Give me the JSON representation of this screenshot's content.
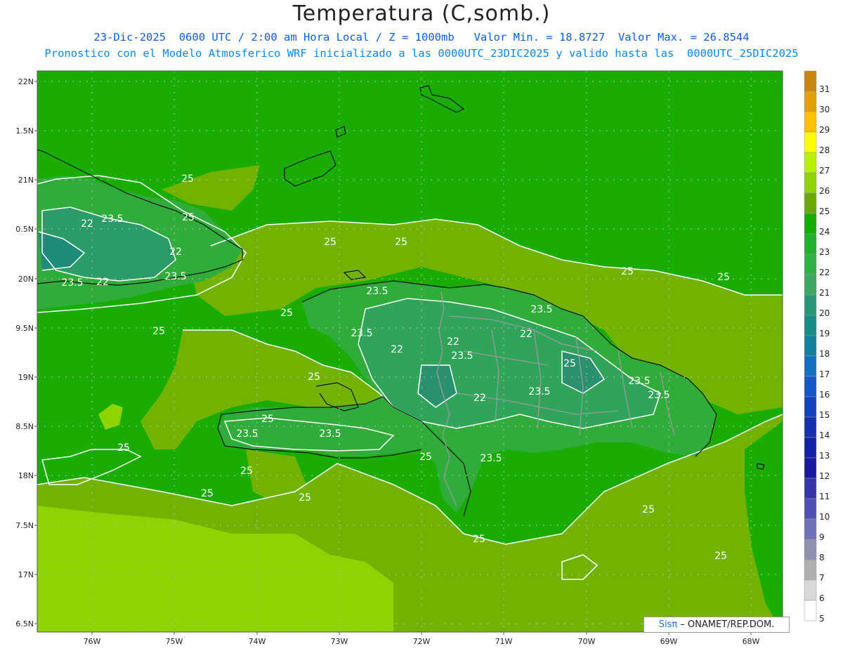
{
  "header": {
    "title": "Temperatura (C,somb.)",
    "line1": "23-Dic-2025  0600 UTC / 2:00 am Hora Local / Z = 1000mb   Valor Min. = 18.8727  Valor Max. = 26.8544",
    "line2": "Pronostico con el Modelo Atmosferico WRF inicializado a las 0000UTC_23DIC2025 y valido hasta las  0000UTC_25DIC2025"
  },
  "axes": {
    "lat_ticks": [
      "22N",
      "1.5N",
      "21N",
      "0.5N",
      "20N",
      "9.5N",
      "19N",
      "8.5N",
      "18N",
      "7.5N",
      "17N",
      "6.5N"
    ],
    "lon_ticks": [
      "76W",
      "75W",
      "74W",
      "73W",
      "72W",
      "71W",
      "70W",
      "69W",
      "68W"
    ]
  },
  "colorbar": {
    "labels": [
      "31",
      "30",
      "29",
      "28",
      "27",
      "26",
      "25",
      "24",
      "23",
      "22",
      "21",
      "20",
      "19",
      "18",
      "17",
      "16",
      "15",
      "14",
      "13",
      "12",
      "11",
      "10",
      "9",
      "8",
      "7",
      "6",
      "5"
    ],
    "colors": [
      "#c8860a",
      "#e0a000",
      "#ffc000",
      "#ffff00",
      "#b8f000",
      "#8ed400",
      "#6aaa00",
      "#15ad00",
      "#22b030",
      "#30b045",
      "#3ea860",
      "#2a9878",
      "#1a8c88",
      "#1480a0",
      "#1570c0",
      "#1556c8",
      "#1540c0",
      "#1530b0",
      "#1520a8",
      "#1a1aa0",
      "#3535a8",
      "#5050b0",
      "#7070b8",
      "#9090b0",
      "#b0b0b0",
      "#d8d8d8",
      "#ffffff"
    ]
  },
  "contour_labels": [
    "25",
    "25",
    "23.5",
    "22",
    "22",
    "23.5",
    "22",
    "23.5",
    "25",
    "25",
    "25",
    "25",
    "25",
    "25",
    "23.5",
    "23.5",
    "22",
    "23.5",
    "22",
    "23.5",
    "22",
    "25",
    "23.5",
    "22",
    "23.5",
    "23.5",
    "25",
    "25",
    "23.5",
    "23.5",
    "25",
    "25",
    "23.5",
    "25",
    "25",
    "25",
    "25",
    "25",
    "25"
  ],
  "credit": {
    "sis": "Sisπ",
    "rest": " – ONAMET/REP.DOM."
  },
  "colors": {
    "land": "#2fac3a",
    "sea_warm": "#72b300",
    "sea_hot": "#8ed400",
    "sea_cool": "#18ad00",
    "contour": "#ffffff",
    "coast": "#111111"
  }
}
